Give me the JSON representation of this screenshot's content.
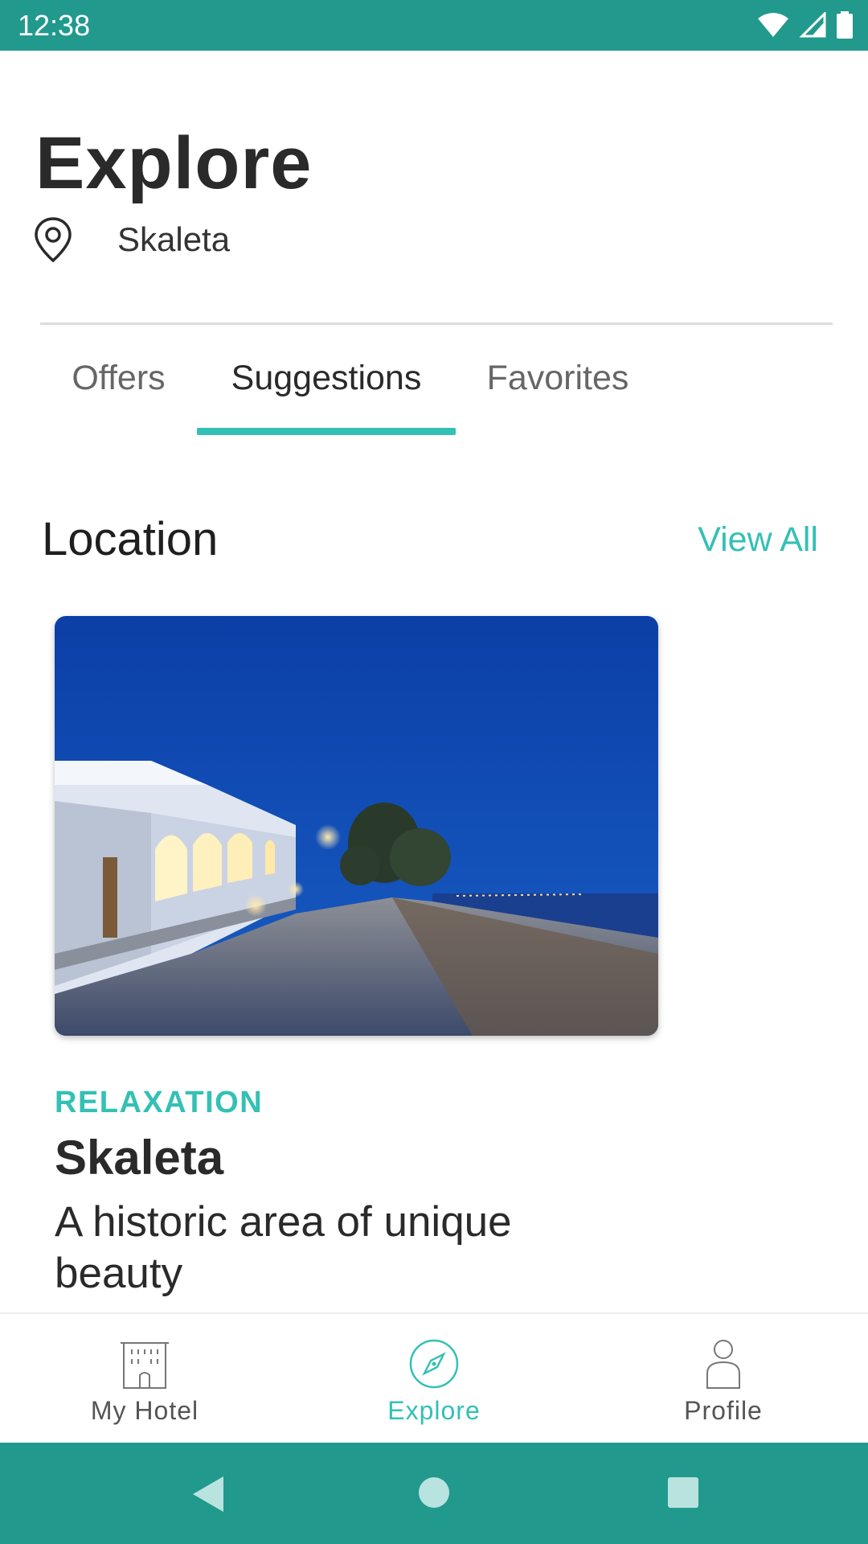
{
  "status_bar": {
    "time": "12:38",
    "icons": [
      "wifi-icon",
      "cellular-signal-icon",
      "battery-icon"
    ],
    "background": "#22998d"
  },
  "header": {
    "title": "Explore",
    "location": "Skaleta",
    "location_icon": "map-pin-icon"
  },
  "tabs": [
    {
      "label": "Offers",
      "active": false
    },
    {
      "label": "Suggestions",
      "active": true
    },
    {
      "label": "Favorites",
      "active": false
    }
  ],
  "section": {
    "title": "Location",
    "view_all_label": "View All"
  },
  "card": {
    "image": "coastal-village-night-photo",
    "category": "RELAXATION",
    "title": "Skaleta",
    "description": "A historic area of unique beauty"
  },
  "bottom_nav": [
    {
      "label": "My Hotel",
      "icon": "hotel-building-icon",
      "active": false
    },
    {
      "label": "Explore",
      "icon": "compass-icon",
      "active": true
    },
    {
      "label": "Profile",
      "icon": "person-icon",
      "active": false
    }
  ],
  "system_nav": {
    "buttons": [
      "back-icon",
      "home-icon",
      "recents-icon"
    ]
  },
  "colors": {
    "accent": "#34c0b5",
    "primary_dark": "#22998d",
    "text": "#2a2a2a"
  }
}
